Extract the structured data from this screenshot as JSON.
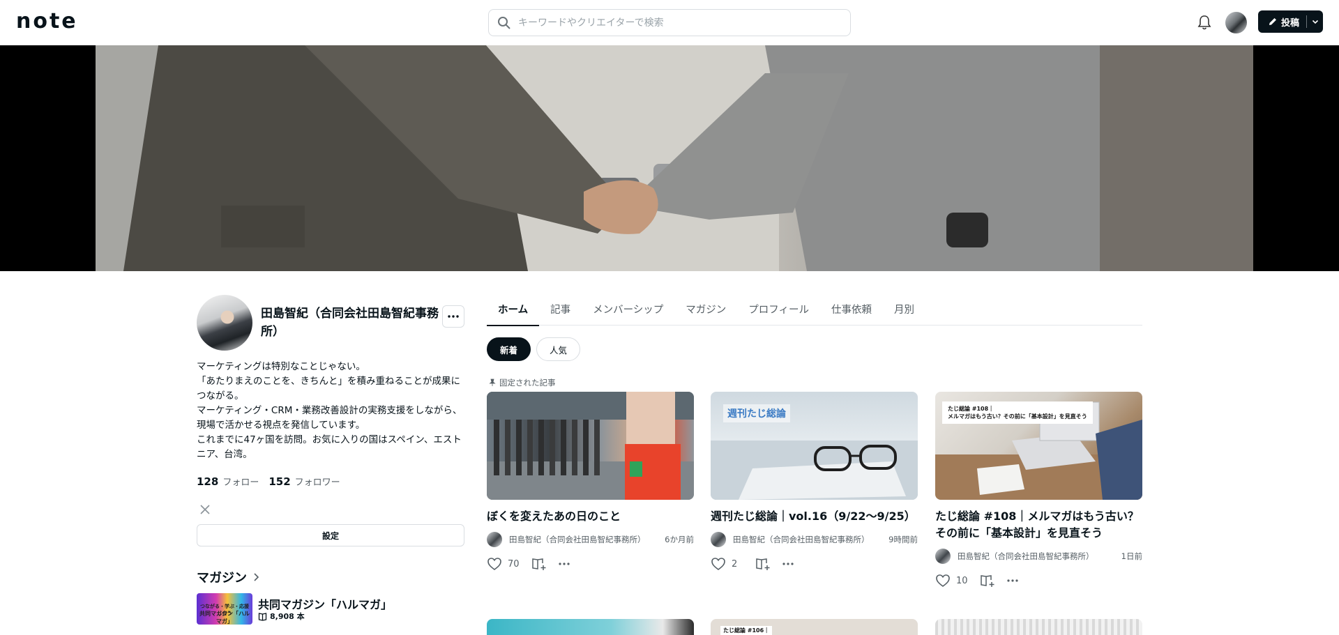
{
  "header": {
    "logo": "note",
    "search_placeholder": "キーワードやクリエイターで検索",
    "post_label": "投稿"
  },
  "profile": {
    "name": "田島智紀（合同会社田島智紀事務所）",
    "bio": "マーケティングは特別なことじゃない。\n「あたりまえのことを、きちんと」を積み重ねることが成果につながる。\nマーケティング・CRM・業務改善設計の実務支援をしながら、現場で活かせる視点を発信しています。\nこれまでに47ヶ国を訪問。お気に入りの国はスペイン、エストニア、台湾。",
    "follow_count": "128",
    "follow_label": "フォロー",
    "follower_count": "152",
    "follower_label": "フォロワー",
    "settings_label": "設定"
  },
  "magazine": {
    "heading": "マガジン",
    "items": [
      {
        "title": "共同マガジン「ハルマガ」",
        "count": "8,908 本",
        "thumb_line1": "つながる・学ぶ・応援し合う",
        "thumb_line2": "共同マガジン「ハルマガ」"
      }
    ]
  },
  "tabs": [
    "ホーム",
    "記事",
    "メンバーシップ",
    "マガジン",
    "プロフィール",
    "仕事依頼",
    "月別"
  ],
  "pills": [
    "新着",
    "人気"
  ],
  "pinned_label": "固定された記事",
  "cards": [
    {
      "title": "ぼくを変えたあの日のこと",
      "author": "田島智紀（合同会社田島智紀事務所）",
      "time": "6か月前",
      "likes": "70",
      "thumb_label": ""
    },
    {
      "title": "週刊たじ総論｜vol.16（9/22〜9/25）",
      "author": "田島智紀（合同会社田島智紀事務所）",
      "time": "9時間前",
      "likes": "2",
      "thumb_label": "週刊たじ総論"
    },
    {
      "title": "たじ総論 #108｜メルマガはもう古い？その前に「基本設計」を見直そう",
      "author": "田島智紀（合同会社田島智紀事務所）",
      "time": "1日前",
      "likes": "10",
      "thumb_label": "たじ総論 #108｜\nメルマガはもう古い？その前に「基本設計」を見直そう"
    }
  ],
  "bottom_thumbs": [
    "",
    "たじ総論 #106｜",
    ""
  ]
}
